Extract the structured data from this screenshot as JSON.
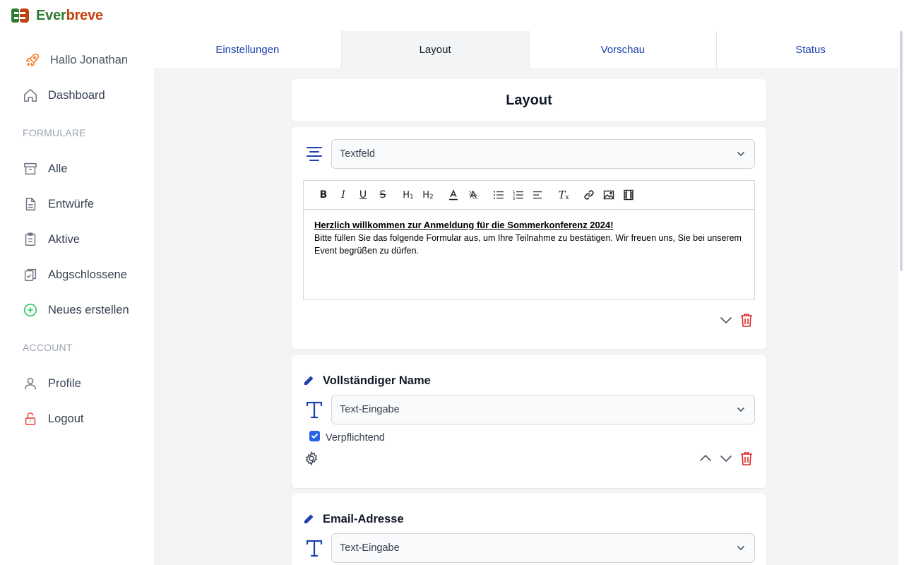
{
  "app": {
    "name_part1": "Ever",
    "name_part2": "breve"
  },
  "sidebar": {
    "greeting": "Hallo Jonathan",
    "dashboard": "Dashboard",
    "section_forms": "FORMULARE",
    "items": [
      {
        "label": "Alle",
        "icon": "archive-icon"
      },
      {
        "label": "Entwürfe",
        "icon": "document-icon"
      },
      {
        "label": "Aktive",
        "icon": "clipboard-icon"
      },
      {
        "label": "Abgschlossene",
        "icon": "clipboard-check-icon"
      },
      {
        "label": "Neues erstellen",
        "icon": "plus-circle-icon"
      }
    ],
    "section_account": "ACCOUNT",
    "profile": "Profile",
    "logout": "Logout"
  },
  "tabs": [
    {
      "label": "Einstellungen",
      "active": false
    },
    {
      "label": "Layout",
      "active": true
    },
    {
      "label": "Vorschau",
      "active": false
    },
    {
      "label": "Status",
      "active": false
    }
  ],
  "main": {
    "title": "Layout",
    "blocks": [
      {
        "type_selected": "Textfeld",
        "editor": {
          "heading": "Herzlich willkommen zur Anmeldung für die Sommerkonferenz 2024!",
          "body": "Bitte füllen Sie das folgende Formular aus, um Ihre Teilnahme zu bestätigen. Wir freuen uns, Sie bei unserem Event begrüßen zu dürfen."
        }
      },
      {
        "title": "Vollständiger Name",
        "type_selected": "Text-Eingabe",
        "required_label": "Verpflichtend",
        "required": true
      },
      {
        "title": "Email-Adresse",
        "type_selected": "Text-Eingabe"
      }
    ]
  },
  "colors": {
    "accent": "#1e40af",
    "brand_green": "#2e7d32",
    "brand_orange": "#c2410c",
    "danger": "#dc2626",
    "success": "#22c55e"
  }
}
